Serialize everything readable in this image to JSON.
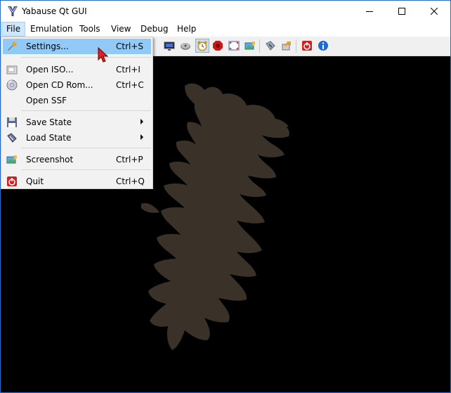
{
  "window": {
    "title": "Yabause Qt GUI",
    "app_icon": "yabause-logo-icon"
  },
  "menubar": {
    "items": [
      "File",
      "Emulation",
      "Tools",
      "View",
      "Debug",
      "Help"
    ],
    "active": "File"
  },
  "file_menu": {
    "items": [
      {
        "label": "Settings...",
        "shortcut": "Ctrl+S",
        "icon": "wrench-icon",
        "highlighted": true
      },
      {
        "label": "Open ISO...",
        "shortcut": "Ctrl+I",
        "icon": "iso-file-icon"
      },
      {
        "label": "Open CD Rom...",
        "shortcut": "Ctrl+C",
        "icon": "cd-rom-icon"
      },
      {
        "label": "Open SSF",
        "shortcut": "",
        "icon": ""
      },
      {
        "label": "Save State",
        "shortcut": "",
        "icon": "floppy-disk-icon",
        "submenu": true
      },
      {
        "label": "Load State",
        "shortcut": "",
        "icon": "load-state-icon",
        "submenu": true
      },
      {
        "label": "Screenshot",
        "shortcut": "Ctrl+P",
        "icon": "screenshot-icon"
      },
      {
        "label": "Quit",
        "shortcut": "Ctrl+Q",
        "icon": "quit-power-icon"
      }
    ]
  },
  "toolbar": {
    "icons": [
      "display-icon",
      "cd-drive-icon",
      "pause-clock-icon",
      "record-icon",
      "fullscreen-icon",
      "screenshot-icon",
      "cartridge-icon",
      "transfer-icon",
      "quit-power-icon",
      "about-info-icon"
    ]
  },
  "colors": {
    "accent": "#91c9f7",
    "blob": "#3a3129",
    "menu_bg": "#f2f2f2"
  }
}
